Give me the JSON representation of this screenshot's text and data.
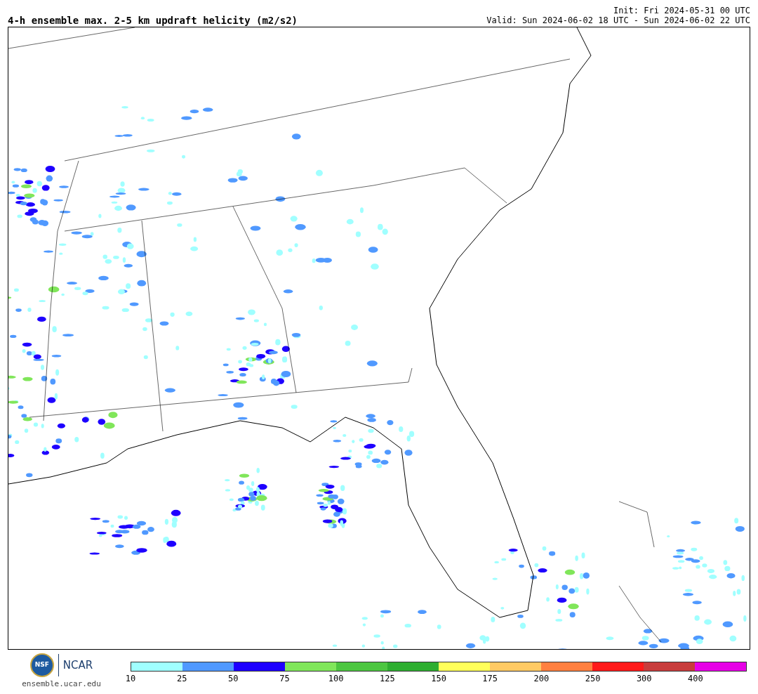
{
  "header": {
    "title": "4-h ensemble max. 2-5 km updraft helicity (m2/s2)",
    "init": "Init: Fri 2024-05-31 00 UTC",
    "valid": "Valid: Sun 2024-06-02 18 UTC - Sun 2024-06-02 22 UTC"
  },
  "footer": {
    "logos": [
      "NSF",
      "NCAR"
    ],
    "site": "ensemble.ucar.edu"
  },
  "colorbar": [
    {
      "label": "10",
      "color": "#a0ffff"
    },
    {
      "label": "25",
      "color": "#5099ff"
    },
    {
      "label": "50",
      "color": "#1e00ff"
    },
    {
      "label": "75",
      "color": "#80e65a"
    },
    {
      "label": "100",
      "color": "#4cc640"
    },
    {
      "label": "125",
      "color": "#2eae30"
    },
    {
      "label": "150",
      "color": "#ffff5a"
    },
    {
      "label": "175",
      "color": "#ffca64"
    },
    {
      "label": "200",
      "color": "#ff8040"
    },
    {
      "label": "250",
      "color": "#ff1a1a"
    },
    {
      "label": "300",
      "color": "#c83c3c"
    },
    {
      "label": "400",
      "color": "#e600e6"
    }
  ]
}
